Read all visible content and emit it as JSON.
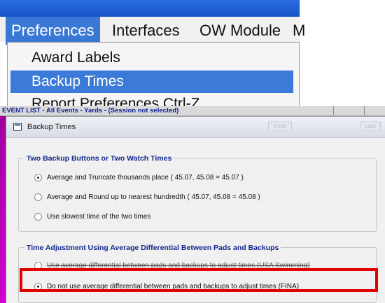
{
  "menu": {
    "items": [
      "Preferences",
      "Interfaces",
      "OW Module",
      "M"
    ],
    "active_index": 0
  },
  "dropdown": {
    "items": [
      "Award Labels",
      "Backup Times",
      "Report Preferences  Ctrl-Z"
    ],
    "highlighted_index": 1
  },
  "background_window": {
    "title": "EVENT LIST - All Events - Yards - (Session not selected)"
  },
  "dialog": {
    "title": "Backup Times",
    "ghost_buttons": [
      "Ends",
      "Last"
    ],
    "group1": {
      "legend": "Two Backup Buttons or Two Watch Times",
      "options": [
        "Average and Truncate thousands place  ( 45.07, 45.08 = 45.07 )",
        "Average and Round up to nearest hundredth  ( 45.07, 45.08 = 45.08 )",
        "Use slowest time of the two times"
      ],
      "selected_index": 0
    },
    "group2": {
      "legend": "Time Adjustment Using Average Differential Between Pads and Backups",
      "options": [
        "Use average differential between pads and backups to adjust times (USA Swimming)",
        "Do not use average differential between pads and backups to adjust times (FINA)"
      ],
      "selected_index": 1
    }
  },
  "colors": {
    "menu_highlight": "#3b7ad8",
    "legend_text": "#12298e",
    "callout_border": "#e00000"
  }
}
